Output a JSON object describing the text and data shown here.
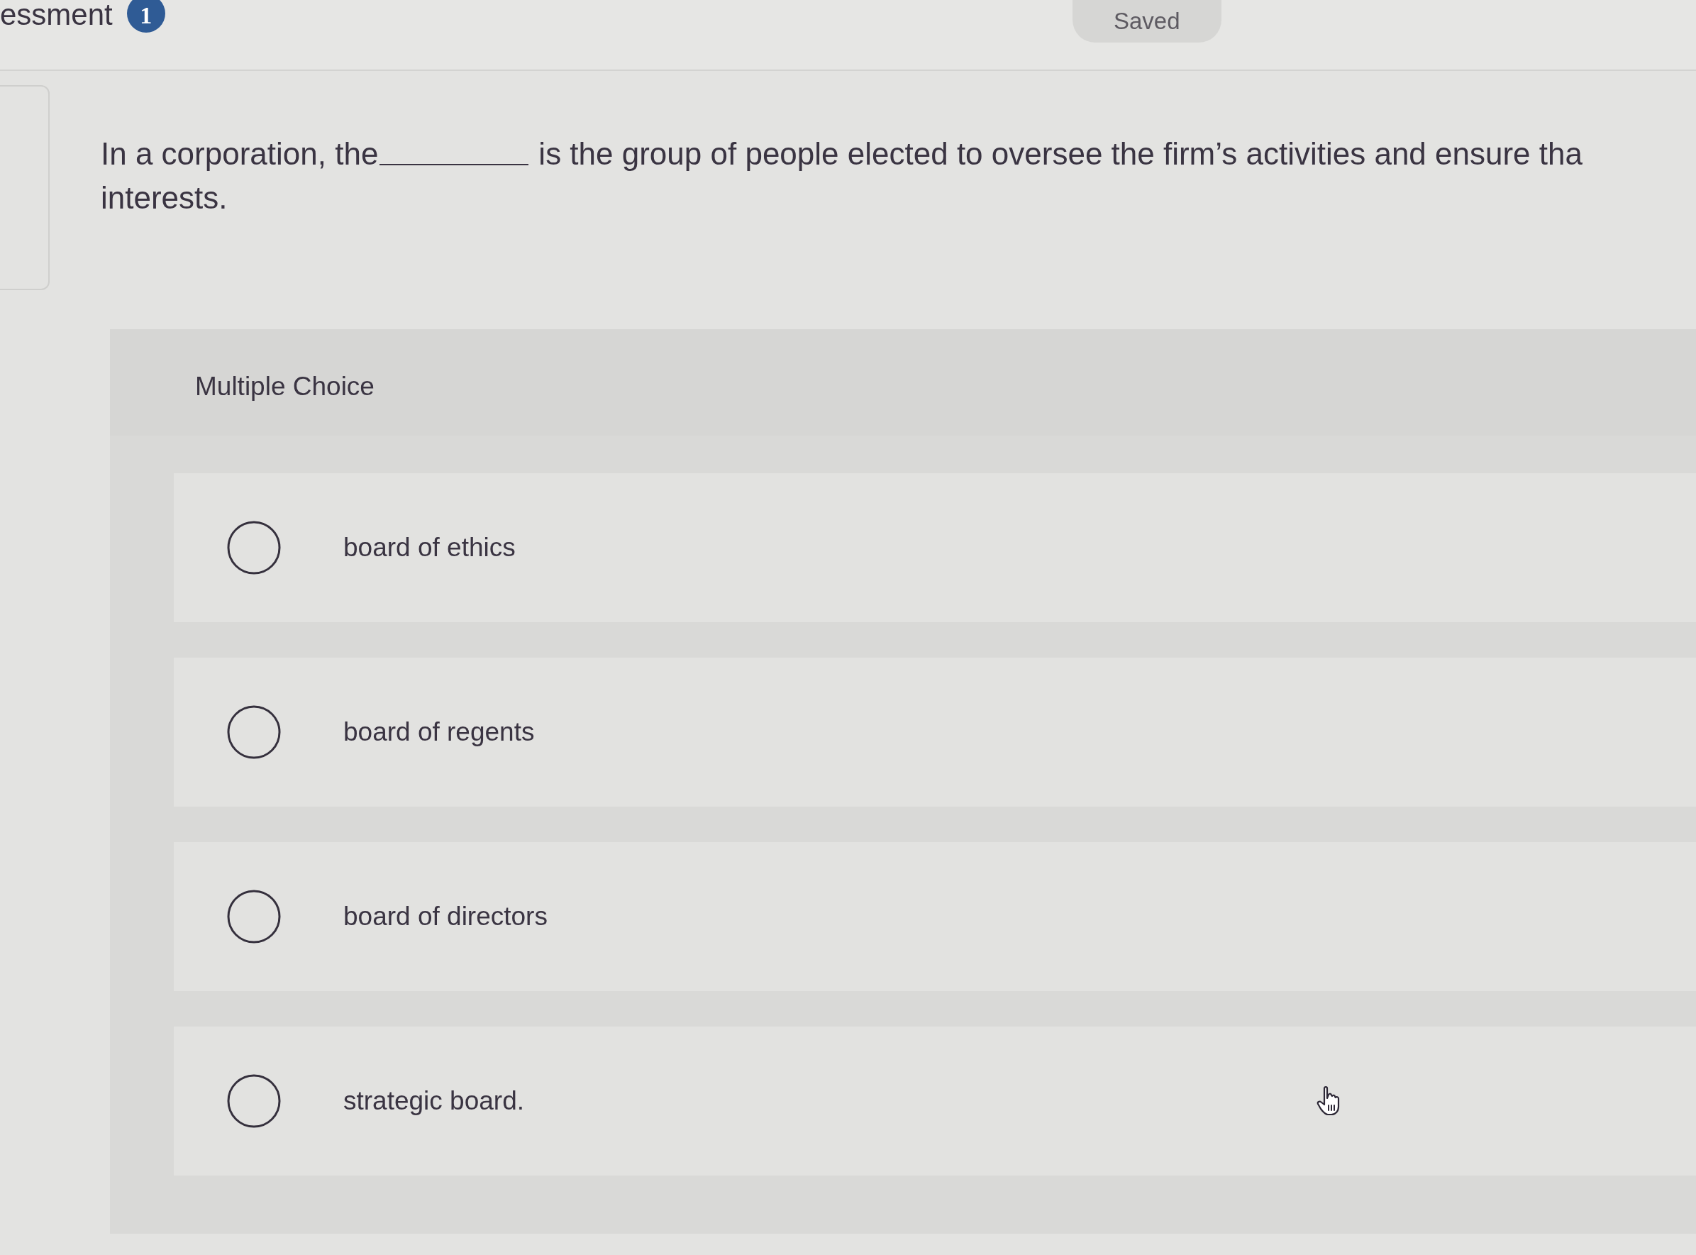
{
  "header": {
    "title": "essment",
    "badge": "1",
    "status": "Saved"
  },
  "question": {
    "text_before_blank": "In a corporation, the",
    "text_after_blank": "is the group of people elected to oversee the firm’s activities and ensure tha",
    "text_continued": "interests."
  },
  "answer_panel": {
    "heading": "Multiple Choice",
    "options": [
      {
        "label": "board of ethics",
        "selected": false
      },
      {
        "label": "board of regents",
        "selected": false
      },
      {
        "label": "board of directors",
        "selected": false
      },
      {
        "label": "strategic board.",
        "selected": false
      }
    ]
  }
}
